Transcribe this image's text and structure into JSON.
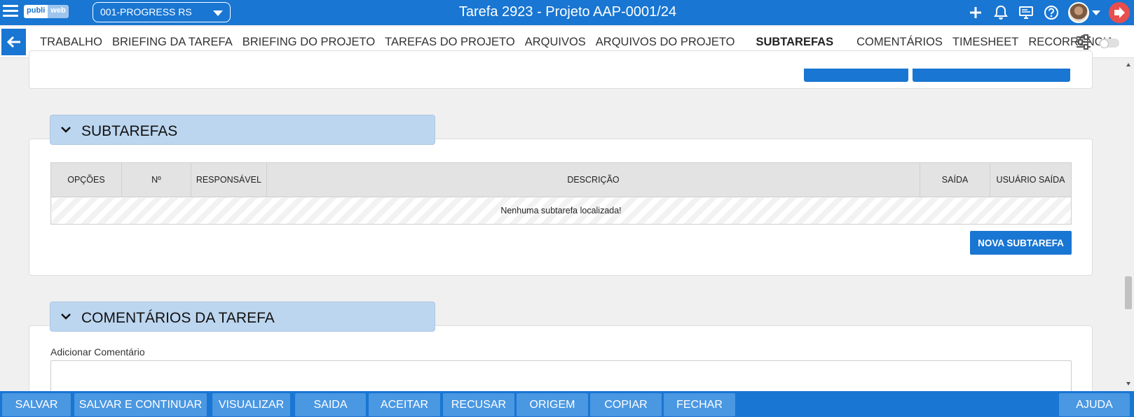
{
  "header": {
    "logo_part1": "publi",
    "logo_part2": "web",
    "company_selected": "001-PROGRESS RS",
    "title": "Tarefa 2923 - Projeto AAP-0001/24"
  },
  "tabs": [
    {
      "label": "TRABALHO"
    },
    {
      "label": "BRIEFING DA TAREFA"
    },
    {
      "label": "BRIEFING DO PROJETO"
    },
    {
      "label": "TAREFAS DO PROJETO"
    },
    {
      "label": "ARQUIVOS"
    },
    {
      "label": "ARQUIVOS DO PROJETO"
    },
    {
      "label": "SUBTAREFAS",
      "active": true
    },
    {
      "label": "COMENTÁRIOS"
    },
    {
      "label": "TIMESHEET"
    },
    {
      "label": "RECORRÊNCIA"
    }
  ],
  "subtasks": {
    "title": "SUBTAREFAS",
    "columns": [
      "OPÇÕES",
      "Nº",
      "RESPONSÁVEL",
      "DESCRIÇÃO",
      "SAÍDA",
      "USUÁRIO SAÍDA"
    ],
    "empty_message": "Nenhuma subtarefa localizada!",
    "new_button": "NOVA SUBTAREFA"
  },
  "comments": {
    "title": "COMENTÁRIOS DA TAREFA",
    "add_label": "Adicionar Comentário",
    "value": ""
  },
  "bottom_buttons": [
    "SALVAR",
    "SALVAR E CONTINUAR",
    "VISUALIZAR",
    "SAIDA",
    "ACEITAR",
    "RECUSAR",
    "ORIGEM",
    "COPIAR",
    "FECHAR"
  ],
  "help_button": "AJUDA",
  "colors": {
    "primary": "#1976d2",
    "section_header": "#bdd6ef",
    "button_light": "#4a97e2",
    "exit": "#e94e4e"
  }
}
